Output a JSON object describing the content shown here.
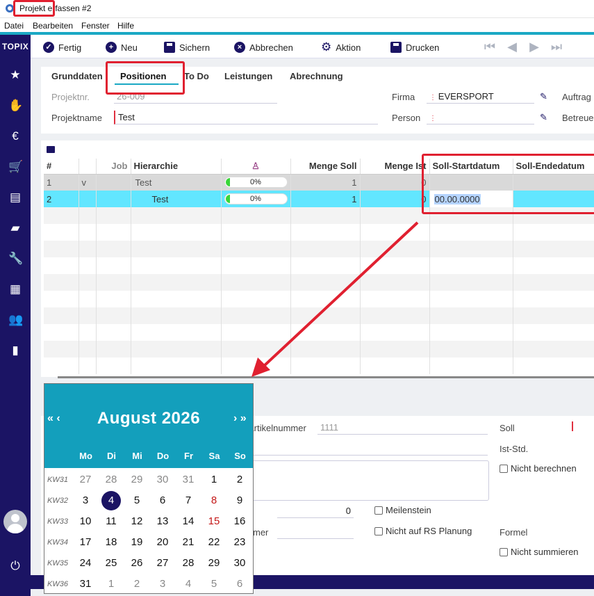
{
  "window": {
    "title": "Projekt erfassen #2"
  },
  "menu": [
    "Datei",
    "Bearbeiten",
    "Fenster",
    "Hilfe"
  ],
  "sidebar": {
    "logo": "TOPIX"
  },
  "toolbar": {
    "fertig": "Fertig",
    "neu": "Neu",
    "sichern": "Sichern",
    "abbrechen": "Abbrechen",
    "aktion": "Aktion",
    "drucken": "Drucken"
  },
  "tabs": [
    "Grunddaten",
    "Positionen",
    "To Do",
    "Leistungen",
    "Abrechnung"
  ],
  "active_tab": "Positionen",
  "form": {
    "projektnr_label": "Projektnr.",
    "projektnr_value": "26-009",
    "projektname_label": "Projektname",
    "projektname_value": "Test",
    "firma_label": "Firma",
    "firma_value": "EVERSPORT",
    "person_label": "Person",
    "person_value": "",
    "auftrag_label": "Auftrag",
    "betreuer_label": "Betreue"
  },
  "grid": {
    "headers": [
      "#",
      "",
      "Job",
      "Hierarchie",
      "",
      "Menge Soll",
      "Menge Ist",
      "Soll-Startdatum",
      "Soll-Endedatum"
    ],
    "rows": [
      {
        "num": "1",
        "v": "v",
        "job": "",
        "hier": "Test",
        "progress": "0%",
        "menge_soll": "1",
        "menge_ist": "0",
        "start": "",
        "end": ""
      },
      {
        "num": "2",
        "v": "",
        "job": "",
        "hier": "Test",
        "progress": "0%",
        "menge_soll": "1",
        "menge_ist": "0",
        "start": "00.00.0000",
        "end": ""
      }
    ]
  },
  "lower": {
    "artikelnummer_label": "Artikelnummer",
    "artikelnummer_value": "1111",
    "soll_label": "Soll",
    "ist_std_label": "Ist-Std.",
    "nicht_berechnen": "Nicht berechnen",
    "qty_value": "0",
    "meilenstein": "Meilenstein",
    "mer_label": "mer",
    "nicht_rs": "Nicht auf RS Planung",
    "formel_label": "Formel",
    "nicht_summieren": "Nicht summieren"
  },
  "calendar": {
    "title": "August 2026",
    "nav_prev": "« ‹",
    "nav_next": "› »",
    "weekdays": [
      "Mo",
      "Di",
      "Mi",
      "Do",
      "Fr",
      "Sa",
      "So"
    ],
    "weeks": [
      {
        "kw": "KW31",
        "days": [
          "27",
          "28",
          "29",
          "30",
          "31",
          "1",
          "2"
        ]
      },
      {
        "kw": "KW32",
        "days": [
          "3",
          "4",
          "5",
          "6",
          "7",
          "8",
          "9"
        ]
      },
      {
        "kw": "KW33",
        "days": [
          "10",
          "11",
          "12",
          "13",
          "14",
          "15",
          "16"
        ]
      },
      {
        "kw": "KW34",
        "days": [
          "17",
          "18",
          "19",
          "20",
          "21",
          "22",
          "23"
        ]
      },
      {
        "kw": "KW35",
        "days": [
          "24",
          "25",
          "26",
          "27",
          "28",
          "29",
          "30"
        ]
      },
      {
        "kw": "KW36",
        "days": [
          "31",
          "1",
          "2",
          "3",
          "4",
          "5",
          "6"
        ]
      }
    ],
    "selected_day": "4"
  },
  "colors": {
    "navy": "#1b1464",
    "teal": "#139fbc",
    "selected_row": "#62e6ff",
    "annotation": "#e02030"
  }
}
